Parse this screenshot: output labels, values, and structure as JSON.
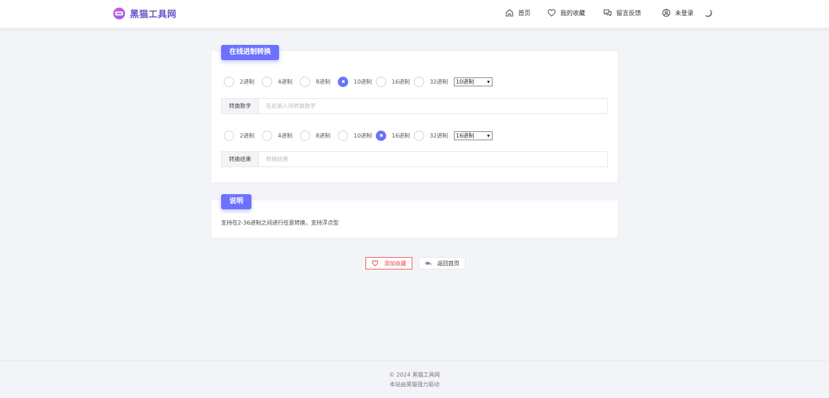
{
  "header": {
    "logo_text": "黑猫工具网",
    "nav": {
      "home": "首页",
      "favorites": "我的收藏",
      "feedback": "留言反馈",
      "login": "未登录"
    }
  },
  "converter": {
    "title": "在线进制转换",
    "input_radios": [
      {
        "label": "2进制",
        "checked": false
      },
      {
        "label": "4进制",
        "checked": false
      },
      {
        "label": "8进制",
        "checked": false
      },
      {
        "label": "10进制",
        "checked": true
      },
      {
        "label": "16进制",
        "checked": false
      },
      {
        "label": "32进制",
        "checked": false
      }
    ],
    "input_select": "10进制",
    "input_label": "转换数字",
    "input_placeholder": "在此输入待转换数字",
    "output_radios": [
      {
        "label": "2进制",
        "checked": false
      },
      {
        "label": "4进制",
        "checked": false
      },
      {
        "label": "8进制",
        "checked": false
      },
      {
        "label": "10进制",
        "checked": false
      },
      {
        "label": "16进制",
        "checked": true
      },
      {
        "label": "32进制",
        "checked": false
      }
    ],
    "output_select": "16进制",
    "output_label": "转换结果",
    "output_placeholder": "转换结果"
  },
  "description": {
    "title": "说明",
    "text": "支持在2-36进制之间进行任意转换，支持浮点型"
  },
  "actions": {
    "add_favorite": "添加收藏",
    "back_home": "返回首页"
  },
  "footer": {
    "copyright": "© 2024 黑猫工具网",
    "powered": "本站由黑猫强力驱动"
  },
  "colors": {
    "accent": "#6c72ff",
    "favorite_red": "#e5484d",
    "logo": "#6a53c4"
  }
}
